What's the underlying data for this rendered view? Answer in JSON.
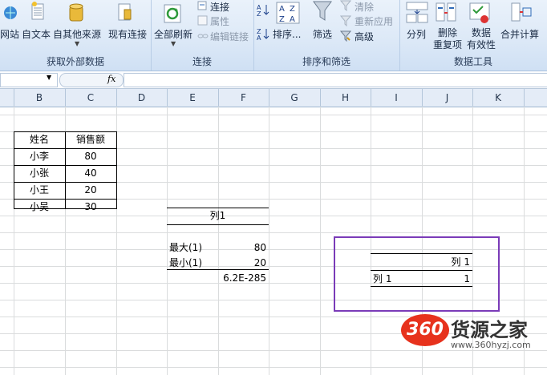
{
  "ribbon": {
    "groups": {
      "external": {
        "label": "获取外部数据",
        "btn_web": "网站",
        "btn_text": "自文本",
        "btn_other": "自其他来源",
        "btn_existing": "现有连接"
      },
      "connections": {
        "label": "连接",
        "btn_refresh_all": "全部刷新",
        "btn_connections": "连接",
        "btn_properties": "属性",
        "btn_edit_links": "编辑链接"
      },
      "sort_filter": {
        "label": "排序和筛选",
        "btn_sort": "排序...",
        "btn_filter": "筛选",
        "btn_clear": "清除",
        "btn_reapply": "重新应用",
        "btn_advanced": "高级"
      },
      "data_tools": {
        "label": "数据工具",
        "btn_text_to_columns": "分列",
        "btn_remove_dup_line1": "删除",
        "btn_remove_dup_line2": "重复项",
        "btn_validation_line1": "数据",
        "btn_validation_line2": "有效性",
        "btn_consolidate": "合并计算"
      }
    }
  },
  "formula_bar": {
    "fx": "fx",
    "value": ""
  },
  "columns": [
    "B",
    "C",
    "D",
    "E",
    "F",
    "G",
    "H",
    "I",
    "J",
    "K"
  ],
  "table1": {
    "headers": [
      "姓名",
      "销售额"
    ],
    "rows": [
      [
        "小李",
        "80"
      ],
      [
        "小张",
        "40"
      ],
      [
        "小王",
        "20"
      ],
      [
        "小吴",
        "30"
      ]
    ]
  },
  "ftest": {
    "title": "列1",
    "rows": [
      {
        "label": "最大(1)",
        "value": "80"
      },
      {
        "label": "最小(1)",
        "value": "20"
      },
      {
        "label": "",
        "value": "6.2E-285"
      }
    ]
  },
  "corr": {
    "col_header": "列 1",
    "row_label": "列 1",
    "value": "1",
    "highlight_color": "#7a3bb8"
  },
  "watermark": {
    "logo": "360",
    "name": "货源之家",
    "url": "www.360hyzj.com"
  }
}
